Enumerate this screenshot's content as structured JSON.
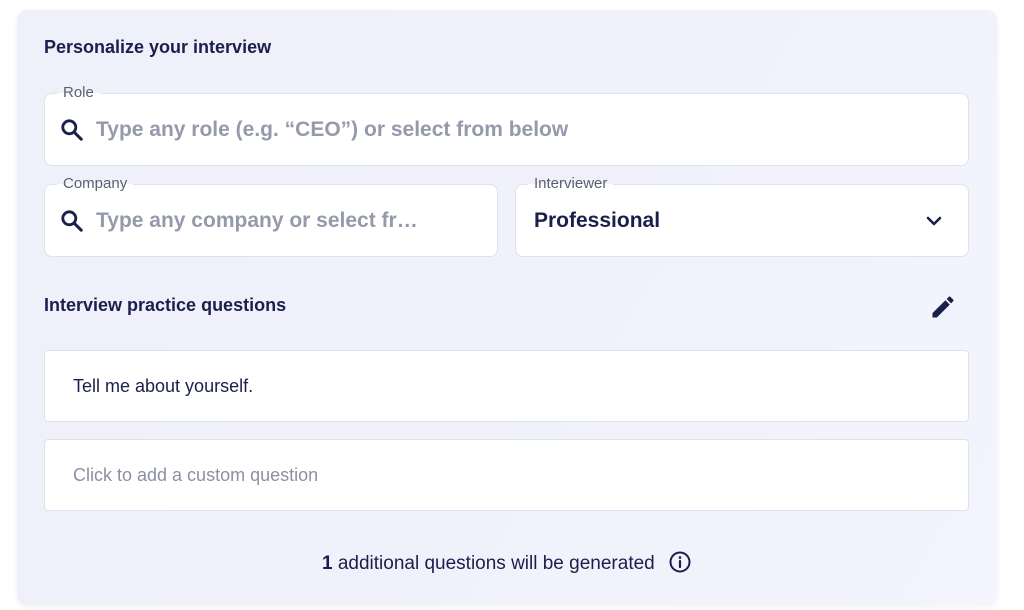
{
  "form": {
    "title": "Personalize your interview",
    "role": {
      "label": "Role",
      "placeholder": "Type any role (e.g. “CEO”) or select from below",
      "value": ""
    },
    "company": {
      "label": "Company",
      "placeholder": "Type any company or select fr…",
      "value": ""
    },
    "interviewer": {
      "label": "Interviewer",
      "selected": "Professional"
    }
  },
  "questions": {
    "title": "Interview practice questions",
    "items": [
      "Tell me about yourself."
    ],
    "custom_placeholder": "Click to add a custom question"
  },
  "footer": {
    "count": "1",
    "text": "additional questions will be generated"
  },
  "icons": {
    "search": "search-icon",
    "edit": "pencil-icon",
    "dropdown": "chevron-down-icon",
    "info": "info-icon"
  },
  "colors": {
    "text_primary": "#1b1f4b",
    "placeholder": "#959aab",
    "panel_bg": "#eff0fa"
  }
}
